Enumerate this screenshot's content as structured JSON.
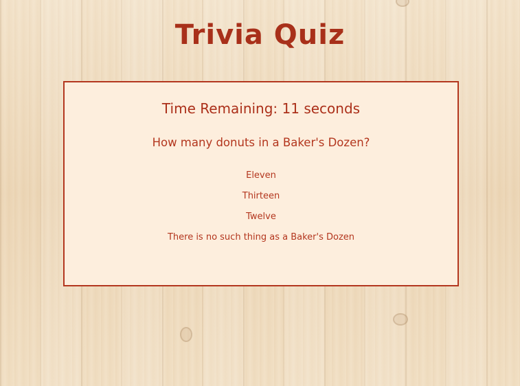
{
  "app": {
    "title": "Trivia Quiz"
  },
  "quiz": {
    "timer_text": "Time Remaining: 11 seconds",
    "question": "How many donuts in a Baker's Dozen?",
    "answers": [
      "Eleven",
      "Thirteen",
      "Twelve",
      "There is no such thing as a Baker's Dozen"
    ]
  },
  "colors": {
    "accent": "#b3361e",
    "card_background": "#fdeedd",
    "wood_background": "#efdcc0"
  }
}
